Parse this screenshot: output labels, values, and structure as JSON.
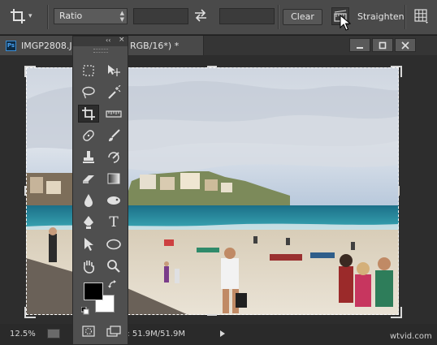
{
  "options_bar": {
    "ratio_select": "Ratio",
    "clear_label": "Clear",
    "straighten_label": "Straighten"
  },
  "document": {
    "title_visible_start": "IMGP2808.J",
    "title_visible_end": "RGB/16*) *",
    "ps_badge": "Ps",
    "zoom": "12.5%",
    "doc_size": "Doc: 51.9M/51.9M"
  },
  "tools_panel": {
    "collapse_label": "‹‹",
    "close_label": "×",
    "type_tool_glyph": "T",
    "tools": [
      "marquee-tool",
      "move-tool",
      "lasso-tool",
      "magic-wand-tool",
      "crop-tool",
      "ruler-tool",
      "spot-healing-tool",
      "brush-tool",
      "clone-stamp-tool",
      "history-brush-tool",
      "eraser-tool",
      "gradient-tool",
      "blur-tool",
      "dodge-tool",
      "pen-tool",
      "type-tool",
      "path-selection-tool",
      "shape-tool",
      "hand-tool",
      "zoom-tool"
    ]
  },
  "watermark": "wtvid.com",
  "colors": {
    "foreground": "#000000",
    "background": "#ffffff",
    "ui_dark": "#2d2d2d",
    "panel": "#4f4f4f"
  }
}
